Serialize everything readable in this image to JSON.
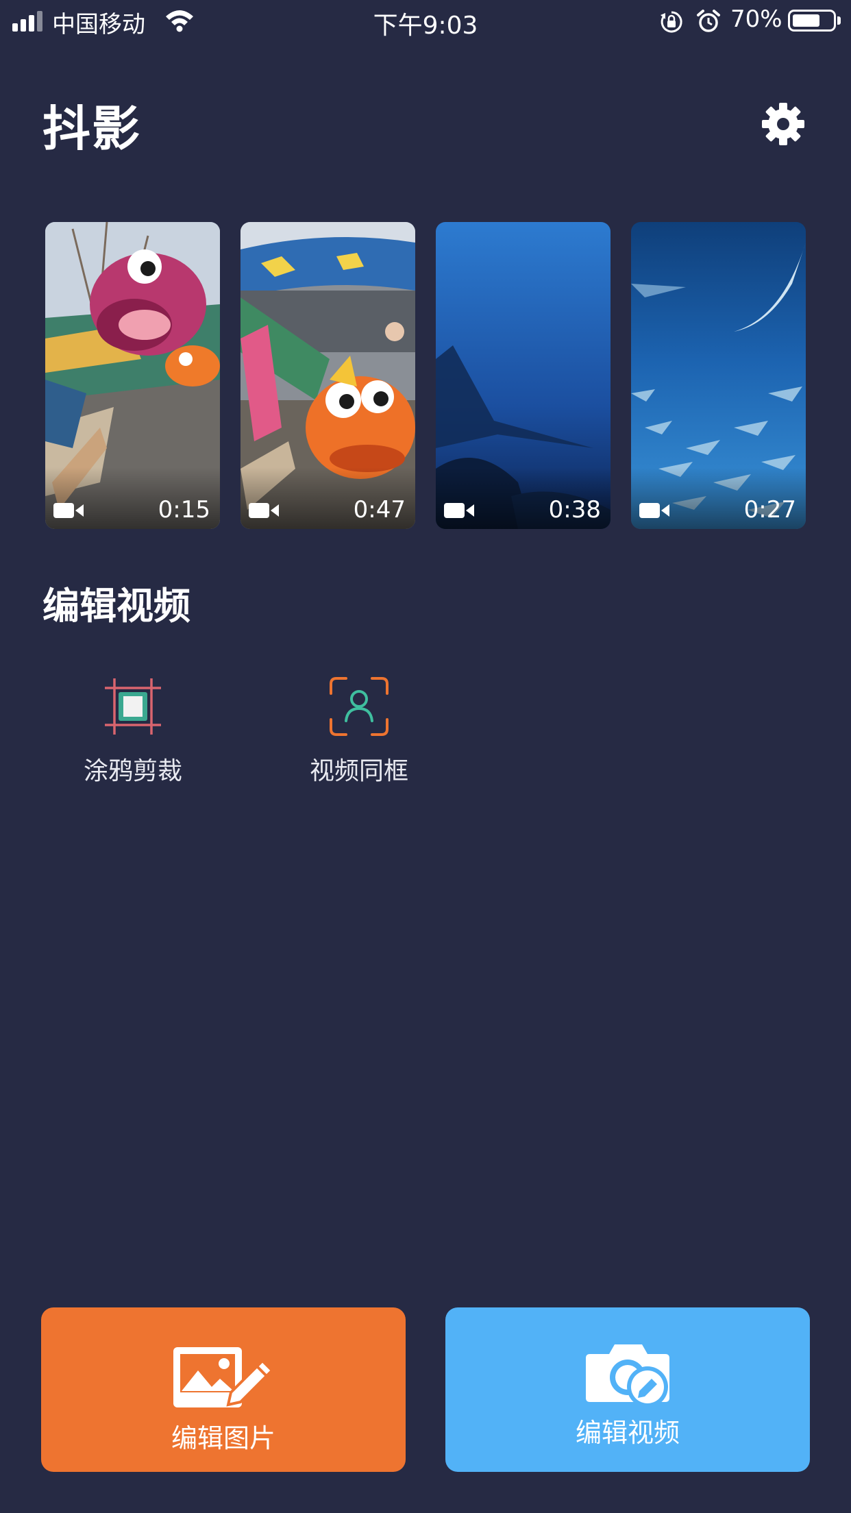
{
  "status_bar": {
    "carrier": "中国移动",
    "time": "下午9:03",
    "battery_percent": "70%",
    "battery_level": 0.7
  },
  "header": {
    "title": "抖影",
    "settings_icon": "gear-icon"
  },
  "recent_videos": [
    {
      "duration": "0:15",
      "scene": "amusement-ride-pink-fish"
    },
    {
      "duration": "0:47",
      "scene": "amusement-ride-orange-fish"
    },
    {
      "duration": "0:38",
      "scene": "aquarium-manta-ray"
    },
    {
      "duration": "0:27",
      "scene": "aquarium-stingrays"
    }
  ],
  "edit_section": {
    "title": "编辑视频",
    "tools": [
      {
        "label": "涂鸦剪裁",
        "icon": "crop-icon",
        "color": "#d9646e"
      },
      {
        "label": "视频同框",
        "icon": "person-frame-icon",
        "color": "#ee7430"
      }
    ]
  },
  "bottom_actions": {
    "edit_photo": {
      "label": "编辑图片",
      "icon": "image-edit-icon",
      "color": "#ee7430"
    },
    "edit_video": {
      "label": "编辑视频",
      "icon": "camera-edit-icon",
      "color": "#52b2f7"
    }
  }
}
